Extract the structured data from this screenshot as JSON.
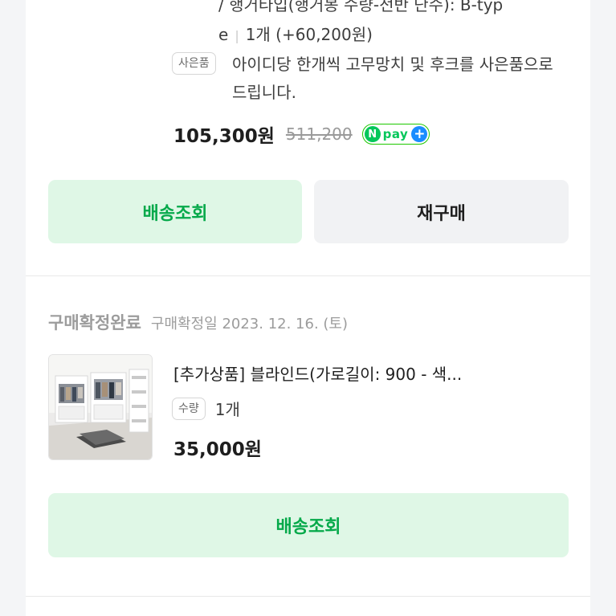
{
  "order1": {
    "option_line1": "/ 행거타입(행거봉 수량-전반 단수): B-typ",
    "option_line2_a": "e",
    "option_line2_b": "1개 (+60,200원)",
    "gift_tag": "사은품",
    "gift_text": "아이디당 한개씩 고무망치 및 후크를 사은품으로 드립니다.",
    "price": "105,300원",
    "original_price": "511,200",
    "npay": {
      "n": "N",
      "label": "pay",
      "plus": "+"
    },
    "track_button": "배송조회",
    "rebuy_button": "재구매"
  },
  "order2": {
    "status": "구매확정완료",
    "status_date": "구매확정일 2023. 12. 16. (토)",
    "product_name": "[추가상품] 블라인드(가로길이: 900 - 색...",
    "qty_tag": "수량",
    "qty_value": "1개",
    "price": "35,000원",
    "track_button": "배송조회"
  },
  "colors": {
    "accent_green": "#05a94a",
    "button_green_bg": "#dff7e6",
    "button_gray_bg": "#f1f2f4",
    "npay_green": "#03c75a",
    "npay_blue": "#1a8cff"
  }
}
